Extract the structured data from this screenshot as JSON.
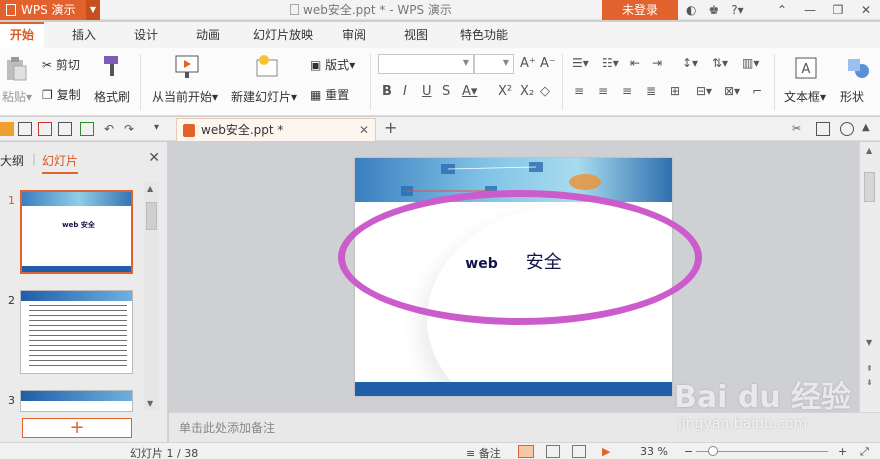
{
  "titlebar": {
    "app_name": "WPS 演示",
    "doc_title": "web安全.ppt * - WPS 演示",
    "login": "未登录",
    "help": "?"
  },
  "menu": {
    "tabs": [
      "开始",
      "插入",
      "设计",
      "动画",
      "幻灯片放映",
      "审阅",
      "视图",
      "特色功能"
    ]
  },
  "ribbon": {
    "paste": "粘贴",
    "cut": "剪切",
    "copy": "复制",
    "format_painter": "格式刷",
    "from_current": "从当前开始",
    "new_slide": "新建幻灯片",
    "layout": "版式",
    "reset": "重置",
    "textbox": "文本框",
    "shape": "形状"
  },
  "qat": {
    "doc_tab": "web安全.ppt *"
  },
  "left_panel": {
    "tab_outline": "大纲",
    "tab_slides": "幻灯片",
    "thumbs": [
      {
        "num": "1",
        "title": "web    安全"
      },
      {
        "num": "2",
        "title": ""
      },
      {
        "num": "3",
        "title": ""
      }
    ]
  },
  "slide": {
    "title_latin": "web",
    "title_cjk": "安全"
  },
  "notes": {
    "placeholder": "单击此处添加备注"
  },
  "statusbar": {
    "slide_counter": "幻灯片 1 / 38",
    "notes_label": "备注",
    "zoom": "33 %"
  },
  "watermark": {
    "brand": "Bai du 经验",
    "url": "jingyan.baidu.com"
  },
  "colors": {
    "accent": "#e2622d",
    "highlight_ellipse": "#cc5ccc",
    "slide_blue": "#1f5ea8"
  }
}
